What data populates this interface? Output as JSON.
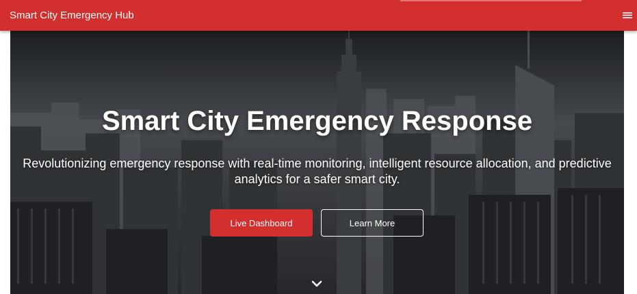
{
  "navbar": {
    "brand": "Smart City Emergency Hub",
    "menu_icon": "hamburger-menu-icon",
    "background_color": "#d32f2f"
  },
  "hero": {
    "title": "Smart City Emergency Response",
    "subtitle": "Revolutionizing emergency response with real-time monitoring, intelligent resource allocation, and predictive analytics for a safer smart city.",
    "background_image": "city-skyline-photo",
    "primary_button": "Live Dashboard",
    "secondary_button": "Learn More",
    "scroll_icon": "chevron-down-icon"
  },
  "colors": {
    "accent": "#d32f2f",
    "text_on_dark": "#ffffff"
  }
}
